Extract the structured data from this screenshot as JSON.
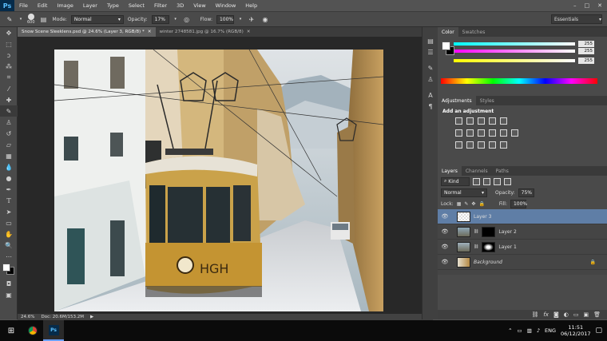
{
  "menu": {
    "logo": "Ps",
    "items": [
      "File",
      "Edit",
      "Image",
      "Layer",
      "Type",
      "Select",
      "Filter",
      "3D",
      "View",
      "Window",
      "Help"
    ]
  },
  "options": {
    "brush_size": "600",
    "mode_label": "Mode:",
    "mode_value": "Normal",
    "opacity_label": "Opacity:",
    "opacity_value": "17%",
    "flow_label": "Flow:",
    "flow_value": "100%",
    "workspace": "Essentials"
  },
  "tabs": [
    {
      "label": "Snow Scene Sleeklens.psd @ 24.6% (Layer 3, RGB/8) *"
    },
    {
      "label": "winter 2748581.jpg @ 16.7% (RGB/8)"
    }
  ],
  "status": {
    "zoom": "24.6%",
    "doc": "Doc: 20.6M/153.2M"
  },
  "color_panel": {
    "tabs": [
      "Color",
      "Swatches"
    ],
    "values": [
      "255",
      "255",
      "255"
    ],
    "fg_color": "#ffffff",
    "bg_color": "#000000"
  },
  "adjustments_panel": {
    "tabs": [
      "Adjustments",
      "Styles"
    ],
    "heading": "Add an adjustment"
  },
  "layers_panel": {
    "tabs": [
      "Layers",
      "Channels",
      "Paths"
    ],
    "kind_label": "Kind",
    "blend_mode": "Normal",
    "opacity_label": "Opacity:",
    "opacity_value": "75%",
    "lock_label": "Lock:",
    "fill_label": "Fill:",
    "fill_value": "100%",
    "layers": [
      {
        "name": "Layer 3",
        "selected": true
      },
      {
        "name": "Layer 2",
        "selected": false
      },
      {
        "name": "Layer 1",
        "selected": false
      },
      {
        "name": "Background",
        "selected": false
      }
    ]
  },
  "taskbar": {
    "language": "ENG",
    "time": "11:51",
    "date": "06/12/2017"
  }
}
